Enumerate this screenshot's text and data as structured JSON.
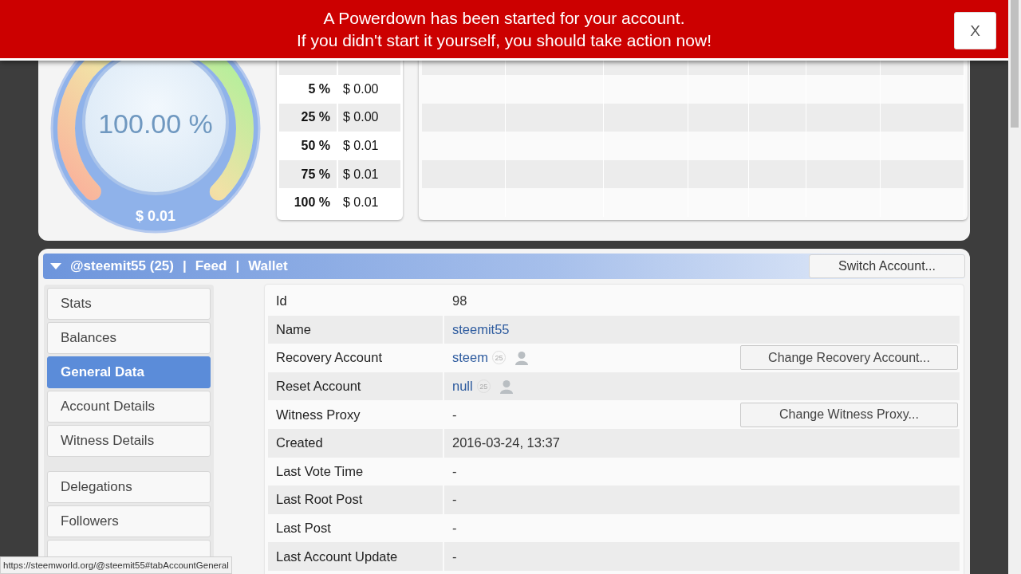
{
  "banner": {
    "lines": [
      "A Powerdown has been started for your account.",
      "If you didn't start it yourself, you should take action now!"
    ],
    "close": "X"
  },
  "gauge": {
    "percent": "100.00 %",
    "value": "$ 0.01",
    "level": 1
  },
  "vote_values": [
    {
      "percent": "5 %",
      "value": "$ 0.00"
    },
    {
      "percent": "25 %",
      "value": "$ 0.00"
    },
    {
      "percent": "50 %",
      "value": "$ 0.01"
    },
    {
      "percent": "75 %",
      "value": "$ 0.01"
    },
    {
      "percent": "100 %",
      "value": "$ 0.01"
    }
  ],
  "account_bar": {
    "expanded": true,
    "links": [
      "@steemit55 (25)",
      "Feed",
      "Wallet"
    ],
    "separator": "|",
    "switch_button": "Switch Account..."
  },
  "sidebar": {
    "groups": [
      [
        {
          "label": "Stats",
          "selected": false
        },
        {
          "label": "Balances",
          "selected": false
        },
        {
          "label": "General Data",
          "selected": true
        },
        {
          "label": "Account Details",
          "selected": false
        },
        {
          "label": "Witness Details",
          "selected": false
        }
      ],
      [
        {
          "label": "Delegations",
          "selected": false
        },
        {
          "label": "Followers",
          "selected": false
        },
        {
          "selected": false
        }
      ]
    ]
  },
  "general_data": [
    {
      "label": "Id",
      "kind": "text",
      "value": "98"
    },
    {
      "label": "Name",
      "kind": "link",
      "value": "steemit55"
    },
    {
      "label": "Recovery Account",
      "kind": "account",
      "value": "steem",
      "badge": "25",
      "action": "Change Recovery Account..."
    },
    {
      "label": "Reset Account",
      "kind": "account",
      "value": "null",
      "badge": "25"
    },
    {
      "label": "Witness Proxy",
      "kind": "text",
      "value": "-",
      "action": "Change Witness Proxy..."
    },
    {
      "label": "Created",
      "kind": "text",
      "value": "2016-03-24, 13:37"
    },
    {
      "label": "Last Vote Time",
      "kind": "text",
      "value": "-"
    },
    {
      "label": "Last Root Post",
      "kind": "text",
      "value": "-"
    },
    {
      "label": "Last Post",
      "kind": "text",
      "value": "-"
    },
    {
      "label": "Last Account Update",
      "kind": "text",
      "value": "-"
    }
  ],
  "status_url": "https://steemworld.org/@steemit55#tabAccountGeneral"
}
